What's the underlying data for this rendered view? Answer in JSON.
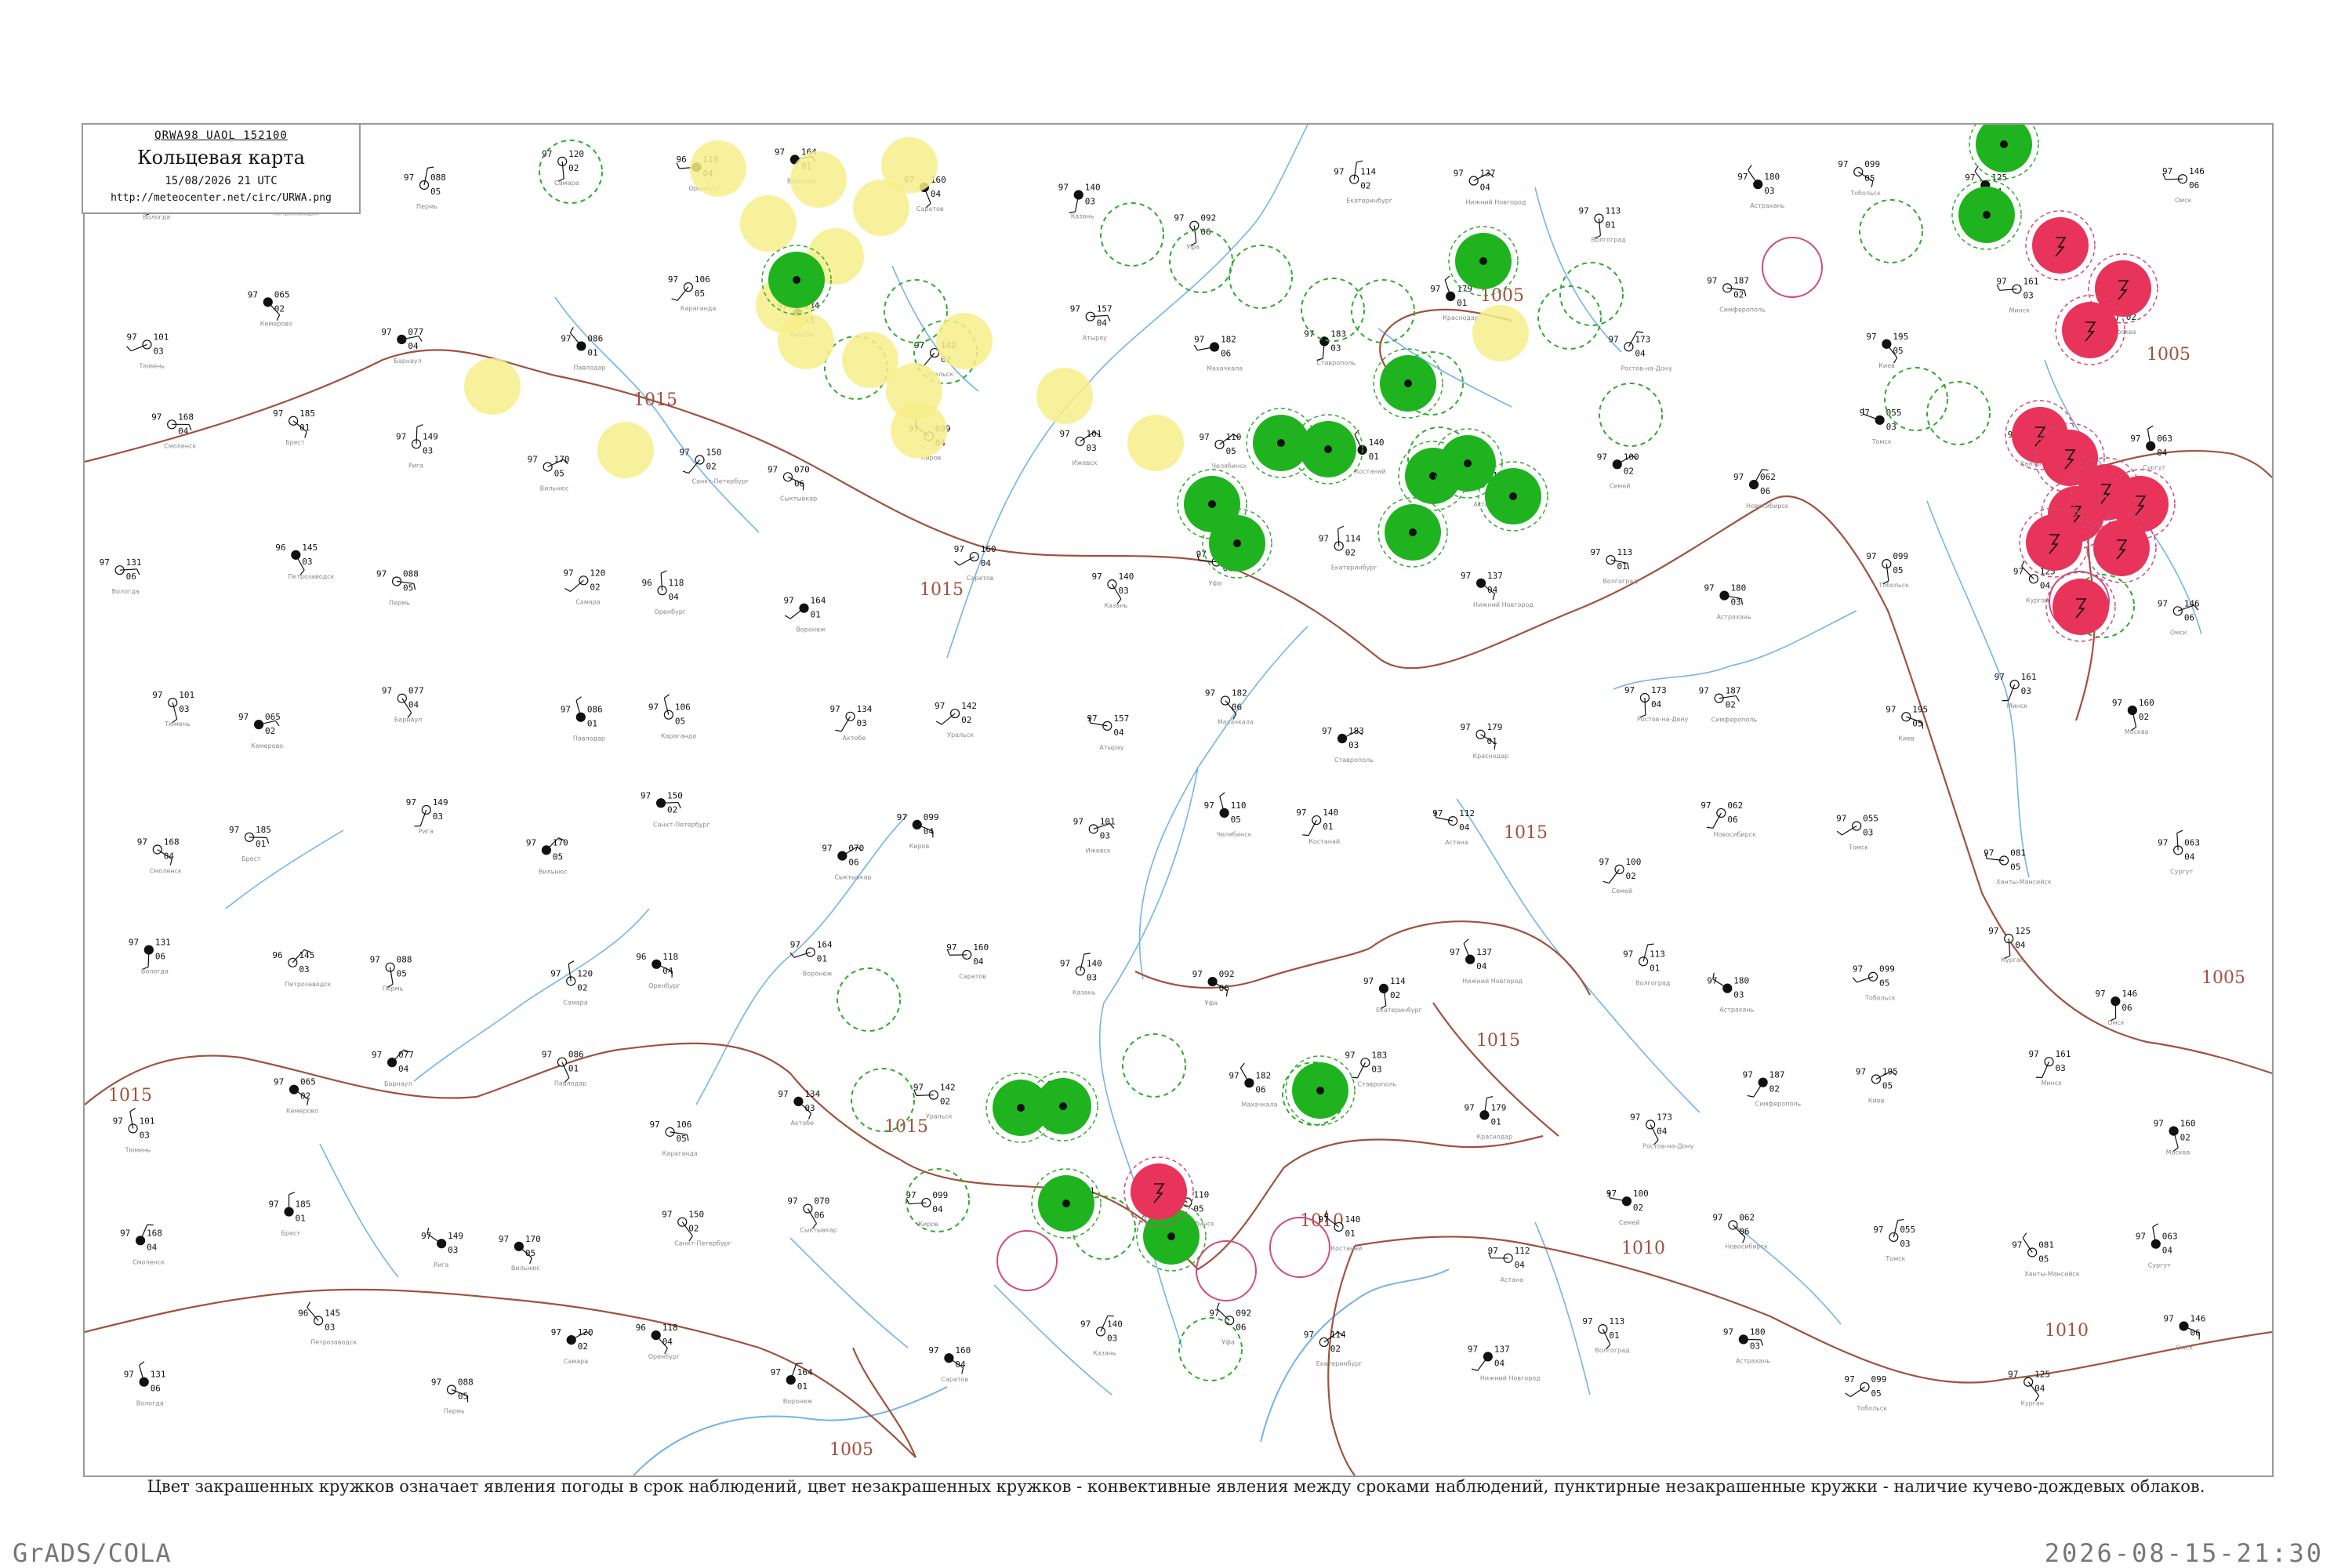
{
  "header": {
    "code_line": "QRWA98  UAOL  152100",
    "title": "Кольцевая карта",
    "time": "15/08/2026 21 UTC",
    "url": "http://meteocenter.net/circ/URWA.png"
  },
  "caption": "Цвет закрашенных кружков означает явления погоды в срок наблюдений, цвет незакрашенных кружков - конвективные явления между сроками наблюдений, пунктирные незакрашенные кружки - наличие кучево-дождевых облаков.",
  "footer": {
    "left": "GrADS/COLA",
    "right": "2026-08-15-21:30"
  },
  "colors": {
    "isobar": "#a0523d",
    "river": "#74b4e8",
    "rain_fill": "#1fb41f",
    "storm_fill": "#e8335a",
    "fog_fill": "#f7ee8a",
    "cb_dashed": "#2eaa2e",
    "convective_ring": "#d04a7a"
  },
  "isobars": [
    {
      "value": "1015",
      "labels": [
        "1015",
        "1015",
        "1015",
        "1015",
        "1015",
        "1015"
      ]
    },
    {
      "value": "1010",
      "labels": [
        "1010",
        "1010",
        "1010"
      ]
    },
    {
      "value": "1005",
      "labels": [
        "1005",
        "1005",
        "1005",
        "1005"
      ]
    }
  ],
  "stations": [
    {
      "name": "Вологда",
      "pressure": "131",
      "temp": "97",
      "dew": "06"
    },
    {
      "name": "Петрозаводск",
      "pressure": "145",
      "temp": "96",
      "dew": "03"
    },
    {
      "name": "Пермь",
      "pressure": "088",
      "temp": "97",
      "dew": "05"
    },
    {
      "name": "Самара",
      "pressure": "120",
      "temp": "97",
      "dew": "02"
    },
    {
      "name": "Оренбург",
      "pressure": "118",
      "temp": "96",
      "dew": "04"
    },
    {
      "name": "Воронеж",
      "pressure": "164",
      "temp": "97",
      "dew": "01"
    },
    {
      "name": "Саратов",
      "pressure": "160",
      "temp": "97",
      "dew": "04"
    },
    {
      "name": "Казань",
      "pressure": "140",
      "temp": "97",
      "dew": "03"
    },
    {
      "name": "Уфа",
      "pressure": "092",
      "temp": "97",
      "dew": "06"
    },
    {
      "name": "Екатеринбург",
      "pressure": "114",
      "temp": "97",
      "dew": "02"
    },
    {
      "name": "Нижний Новгород",
      "pressure": "137",
      "temp": "97",
      "dew": "04"
    },
    {
      "name": "Волгоград",
      "pressure": "113",
      "temp": "97",
      "dew": "01"
    },
    {
      "name": "Астрахань",
      "pressure": "180",
      "temp": "97",
      "dew": "03"
    },
    {
      "name": "Тобольск",
      "pressure": "099",
      "temp": "97",
      "dew": "05"
    },
    {
      "name": "Курган",
      "pressure": "125",
      "temp": "97",
      "dew": "04"
    },
    {
      "name": "Омск",
      "pressure": "146",
      "temp": "97",
      "dew": "06"
    },
    {
      "name": "Тюмень",
      "pressure": "101",
      "temp": "97",
      "dew": "03"
    },
    {
      "name": "Кемерово",
      "pressure": "065",
      "temp": "97",
      "dew": "02"
    },
    {
      "name": "Барнаул",
      "pressure": "077",
      "temp": "97",
      "dew": "04"
    },
    {
      "name": "Павлодар",
      "pressure": "086",
      "temp": "97",
      "dew": "01"
    },
    {
      "name": "Караганда",
      "pressure": "106",
      "temp": "97",
      "dew": "05"
    },
    {
      "name": "Актобе",
      "pressure": "134",
      "temp": "97",
      "dew": "03"
    },
    {
      "name": "Уральск",
      "pressure": "142",
      "temp": "97",
      "dew": "02"
    },
    {
      "name": "Атырау",
      "pressure": "157",
      "temp": "97",
      "dew": "04"
    },
    {
      "name": "Махачкала",
      "pressure": "182",
      "temp": "97",
      "dew": "06"
    },
    {
      "name": "Ставрополь",
      "pressure": "183",
      "temp": "97",
      "dew": "03"
    },
    {
      "name": "Краснодар",
      "pressure": "179",
      "temp": "97",
      "dew": "01"
    },
    {
      "name": "Ростов-на-Дону",
      "pressure": "173",
      "temp": "97",
      "dew": "04"
    },
    {
      "name": "Симферополь",
      "pressure": "187",
      "temp": "97",
      "dew": "02"
    },
    {
      "name": "Киев",
      "pressure": "195",
      "temp": "97",
      "dew": "05"
    },
    {
      "name": "Минск",
      "pressure": "161",
      "temp": "97",
      "dew": "03"
    },
    {
      "name": "Москва",
      "pressure": "160",
      "temp": "97",
      "dew": "02"
    },
    {
      "name": "Смоленск",
      "pressure": "168",
      "temp": "97",
      "dew": "04"
    },
    {
      "name": "Брест",
      "pressure": "185",
      "temp": "97",
      "dew": "01"
    },
    {
      "name": "Рига",
      "pressure": "149",
      "temp": "97",
      "dew": "03"
    },
    {
      "name": "Вильнюс",
      "pressure": "170",
      "temp": "97",
      "dew": "05"
    },
    {
      "name": "Санкт-Петербург",
      "pressure": "150",
      "temp": "97",
      "dew": "02"
    },
    {
      "name": "Сыктывкар",
      "pressure": "070",
      "temp": "97",
      "dew": "06"
    },
    {
      "name": "Киров",
      "pressure": "099",
      "temp": "97",
      "dew": "04"
    },
    {
      "name": "Ижевск",
      "pressure": "101",
      "temp": "97",
      "dew": "03"
    },
    {
      "name": "Челябинск",
      "pressure": "110",
      "temp": "97",
      "dew": "05"
    },
    {
      "name": "Костанай",
      "pressure": "140",
      "temp": "97",
      "dew": "01"
    },
    {
      "name": "Астана",
      "pressure": "112",
      "temp": "97",
      "dew": "04"
    },
    {
      "name": "Семей",
      "pressure": "100",
      "temp": "97",
      "dew": "02"
    },
    {
      "name": "Новосибирск",
      "pressure": "062",
      "temp": "97",
      "dew": "06"
    },
    {
      "name": "Томск",
      "pressure": "055",
      "temp": "97",
      "dew": "03"
    },
    {
      "name": "Ханты-Мансийск",
      "pressure": "081",
      "temp": "97",
      "dew": "05"
    },
    {
      "name": "Сургут",
      "pressure": "063",
      "temp": "97",
      "dew": "04"
    }
  ]
}
